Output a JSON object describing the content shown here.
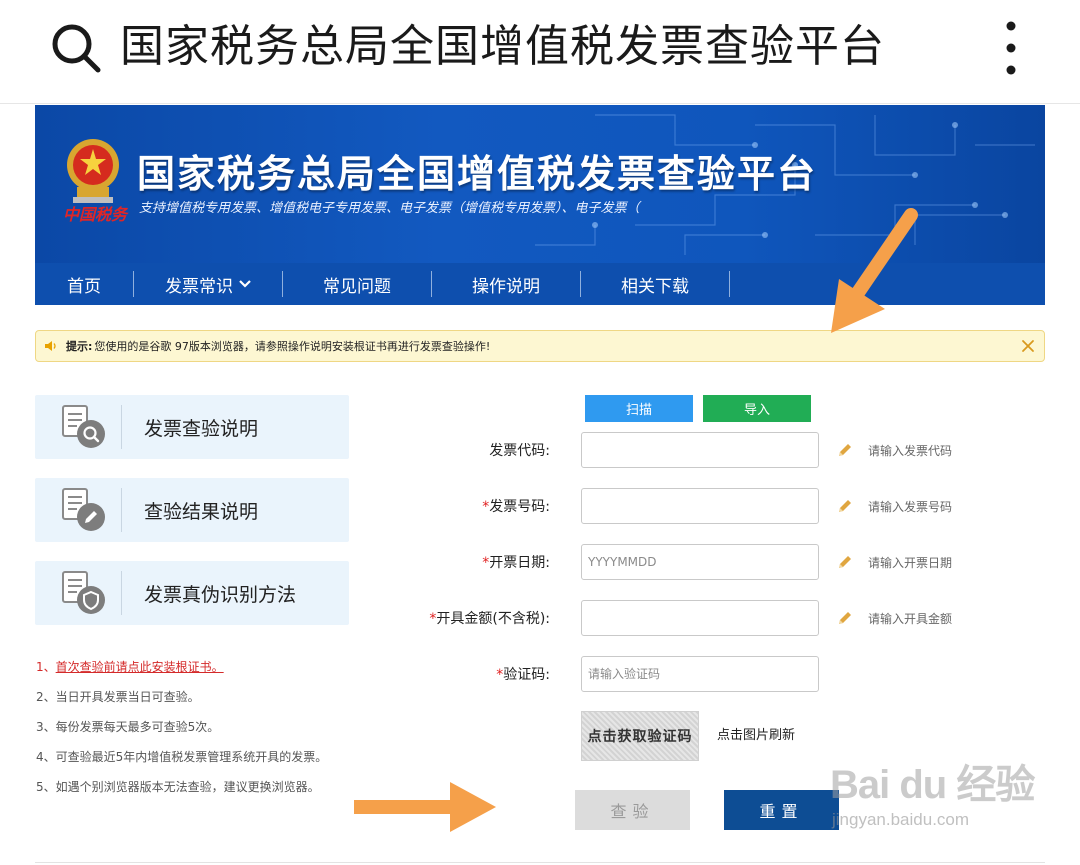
{
  "search_bar": {
    "query": "国家税务总局全国增值税发票查验平台"
  },
  "banner": {
    "title": "国家税务总局全国增值税发票查验平台",
    "subtitle": "支持增值税专用发票、增值税电子专用发票、电子发票（增值税专用发票）、电子发票（",
    "brand_mark": "中国税务"
  },
  "nav": {
    "items": [
      {
        "label": "首页"
      },
      {
        "label": "发票常识",
        "has_dropdown": true
      },
      {
        "label": "常见问题"
      },
      {
        "label": "操作说明"
      },
      {
        "label": "相关下载"
      }
    ]
  },
  "notice": {
    "label": "提示:",
    "text": "您使用的是谷歌 97版本浏览器，请参照操作说明安装根证书再进行发票查验操作!"
  },
  "side_cards": [
    {
      "label": "发票查验说明",
      "icon": "document-search-icon"
    },
    {
      "label": "查验结果说明",
      "icon": "document-edit-icon"
    },
    {
      "label": "发票真伪识别方法",
      "icon": "document-shield-icon"
    }
  ],
  "tips": [
    {
      "prefix": "1、",
      "text": "首次查验前请点此安装根证书。"
    },
    {
      "text": "2、当日开具发票当日可查验。"
    },
    {
      "text": "3、每份发票每天最多可查验5次。"
    },
    {
      "text": "4、可查验最近5年内增值税发票管理系统开具的发票。"
    },
    {
      "text": "5、如遇个别浏览器版本无法查验，建议更换浏览器。"
    }
  ],
  "form": {
    "scan_label": "扫描",
    "import_label": "导入",
    "fields": [
      {
        "label": "发票代码:",
        "required": false,
        "placeholder": "",
        "hint": "请输入发票代码"
      },
      {
        "label": "发票号码:",
        "required": true,
        "placeholder": "",
        "hint": "请输入发票号码"
      },
      {
        "label": "开票日期:",
        "required": true,
        "placeholder": "YYYYMMDD",
        "hint": "请输入开票日期"
      },
      {
        "label": "开具金额(不含税):",
        "required": true,
        "placeholder": "",
        "hint": "请输入开具金额"
      },
      {
        "label": "验证码:",
        "required": true,
        "placeholder": "请输入验证码",
        "hint": ""
      }
    ],
    "required_mark": "*",
    "captcha_text": "点击获取验证码",
    "captcha_refresh": "点击图片刷新",
    "check_label": "查验",
    "reset_label": "重置"
  },
  "watermark": {
    "logo": "Bai du 经验",
    "url": "jingyan.baidu.com"
  },
  "colors": {
    "banner_blue": "#0f56bc",
    "nav_blue": "#0e4fae",
    "scan_blue": "#2f9af0",
    "import_green": "#21ad55",
    "reset_navy": "#0d4d94",
    "required_red": "#e02020",
    "arrow_orange": "#f5a04a"
  }
}
